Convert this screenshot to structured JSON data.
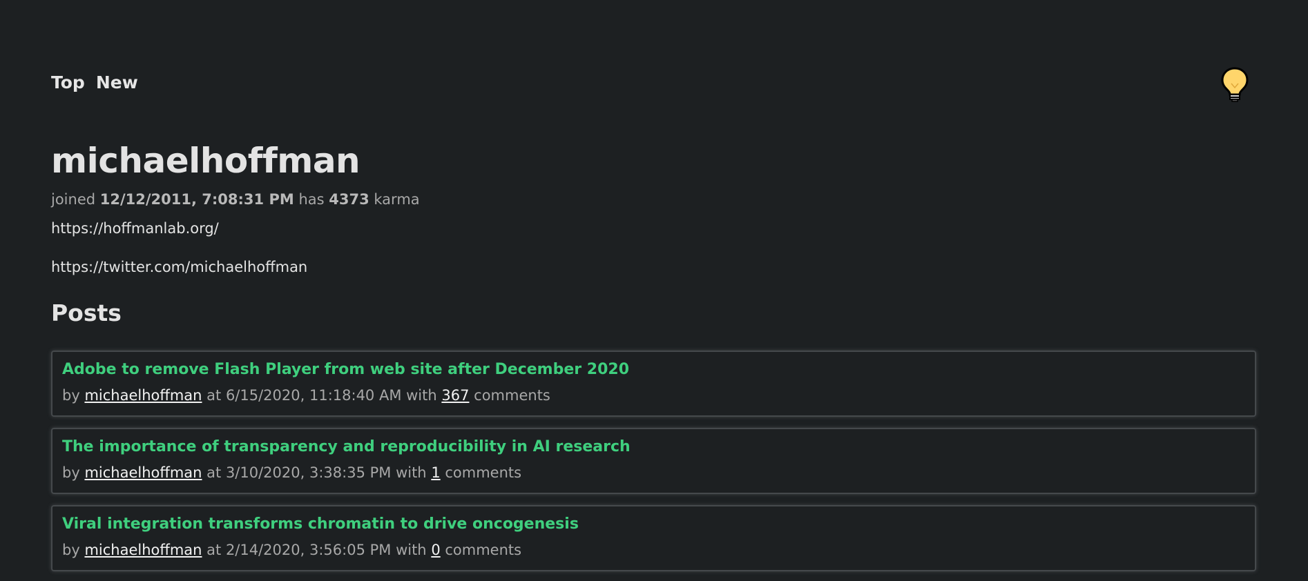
{
  "nav": {
    "top_label": "Top",
    "new_label": "New"
  },
  "theme_toggle": {
    "icon": "lightbulb-icon",
    "color": "#ffd56b"
  },
  "user": {
    "username": "michaelhoffman",
    "joined_prefix": "joined",
    "joined_date": "12/12/2011, 7:08:31 PM",
    "has_label": "has",
    "karma": "4373",
    "karma_label": "karma",
    "about_lines": [
      "https://hoffmanlab.org/",
      "https://twitter.com/michaelhoffman"
    ]
  },
  "posts_heading": "Posts",
  "posts": [
    {
      "title": "Adobe to remove Flash Player from web site after December 2020",
      "by": "by",
      "author": "michaelhoffman",
      "at": "at 6/15/2020, 11:18:40 AM with",
      "comments": "367",
      "comments_label": "comments"
    },
    {
      "title": "The importance of transparency and reproducibility in AI research",
      "by": "by",
      "author": "michaelhoffman",
      "at": "at 3/10/2020, 3:38:35 PM with",
      "comments": "1",
      "comments_label": "comments"
    },
    {
      "title": "Viral integration transforms chromatin to drive oncogenesis",
      "by": "by",
      "author": "michaelhoffman",
      "at": "at 2/14/2020, 3:56:05 PM with",
      "comments": "0",
      "comments_label": "comments"
    }
  ],
  "colors": {
    "background": "#1d2022",
    "post_title": "#3fcf7e",
    "card_border": "#45494c"
  }
}
